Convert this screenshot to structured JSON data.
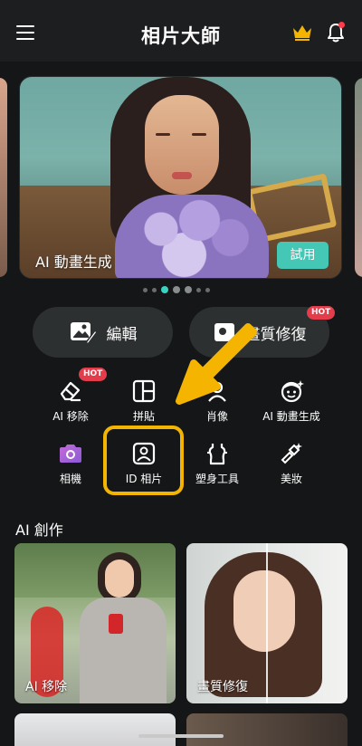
{
  "header": {
    "title": "相片大師",
    "menu_icon": "hamburger-menu-icon",
    "crown_icon": "crown-icon",
    "bell_icon": "bell-icon"
  },
  "banner": {
    "label": "AI 動畫生成",
    "try_label": "試用",
    "page_count": 7,
    "active_index": 2
  },
  "pills": [
    {
      "label": "編輯",
      "icon": "photo-edit-icon"
    },
    {
      "label": "畫質修復",
      "icon": "enhance-icon",
      "badge": "HOT"
    }
  ],
  "tools_row1": [
    {
      "label": "AI 移除",
      "icon": "eraser-icon",
      "badge": "HOT"
    },
    {
      "label": "拼貼",
      "icon": "collage-icon"
    },
    {
      "label": "肖像",
      "icon": "portrait-icon"
    },
    {
      "label": "AI 動畫生成",
      "icon": "ai-face-icon"
    }
  ],
  "tools_row2": [
    {
      "label": "相機",
      "icon": "camera-icon"
    },
    {
      "label": "ID 相片",
      "icon": "id-photo-icon"
    },
    {
      "label": "塑身工具",
      "icon": "body-shape-icon"
    },
    {
      "label": "美妝",
      "icon": "makeup-icon"
    }
  ],
  "section": {
    "title": "AI 創作"
  },
  "cards": [
    {
      "label": "AI 移除"
    },
    {
      "label": "畫質修復"
    }
  ],
  "colors": {
    "accent": "#39d3c1",
    "highlight": "#f4b400",
    "hot": "#e33d4b",
    "background": "#141617"
  }
}
